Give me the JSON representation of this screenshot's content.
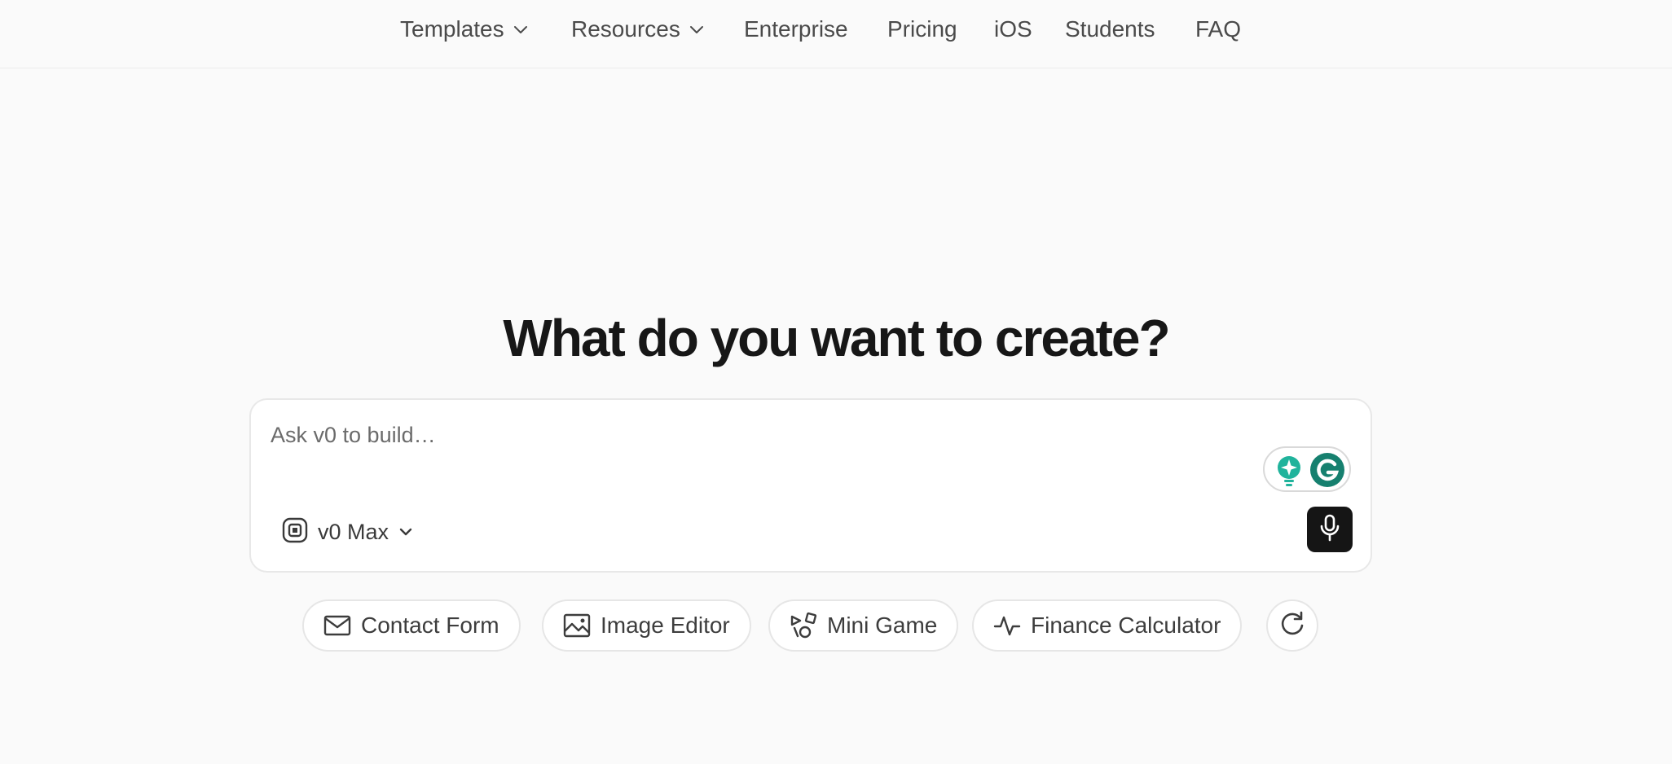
{
  "nav": {
    "items": [
      {
        "label": "Templates",
        "dropdown": true
      },
      {
        "label": "Resources",
        "dropdown": true
      },
      {
        "label": "Enterprise"
      },
      {
        "label": "Pricing"
      },
      {
        "label": "iOS"
      },
      {
        "label": "Students"
      },
      {
        "label": "FAQ"
      }
    ]
  },
  "hero": {
    "title": "What do you want to create?"
  },
  "prompt": {
    "placeholder": "Ask v0 to build…",
    "value": "",
    "model": "v0 Max",
    "model_icon": "model-chip-icon",
    "mic_icon": "microphone-icon"
  },
  "extensions": {
    "grammarly_icons": [
      "lightbulb-sparkle-icon",
      "grammarly-logo-icon"
    ],
    "accent": "#16806f"
  },
  "suggestions": [
    {
      "label": "Contact Form",
      "icon": "mail-icon"
    },
    {
      "label": "Image Editor",
      "icon": "image-icon"
    },
    {
      "label": "Mini Game",
      "icon": "shapes-icon"
    },
    {
      "label": "Finance Calculator",
      "icon": "activity-icon"
    }
  ],
  "refresh_icon": "refresh-icon",
  "colors": {
    "background": "#fafafa",
    "mic_button": "#151515",
    "text": "#171717"
  }
}
